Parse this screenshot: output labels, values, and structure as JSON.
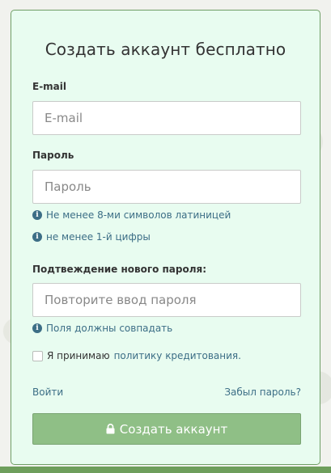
{
  "form": {
    "title": "Создать аккаунт бесплатно",
    "email": {
      "label": "E-mail",
      "placeholder": "E-mail",
      "value": ""
    },
    "password": {
      "label": "Пароль",
      "placeholder": "Пароль",
      "value": "",
      "hints": [
        "Не менее 8-ми символов латиницей",
        "не менее 1-й цифры"
      ]
    },
    "confirm_password": {
      "label": "Подтвеждение нового пароля:",
      "placeholder": "Повторите ввод пароля",
      "value": "",
      "hint": "Поля должны совпадать"
    },
    "agreement": {
      "prefix": "Я принимаю",
      "link_text": "политику кредитования.",
      "checked": false
    },
    "login_link": "Войти",
    "forgot_link": "Забыл пароль?",
    "submit_label": "Создать аккаунт"
  },
  "icons": {
    "info": "info-icon",
    "lock": "lock-icon"
  },
  "colors": {
    "card_background": "#e8fcf0",
    "card_border": "#6f9e66",
    "button_background": "#8fbf86",
    "link": "#3c6e86",
    "bottom_bar": "#6e9e5c"
  }
}
